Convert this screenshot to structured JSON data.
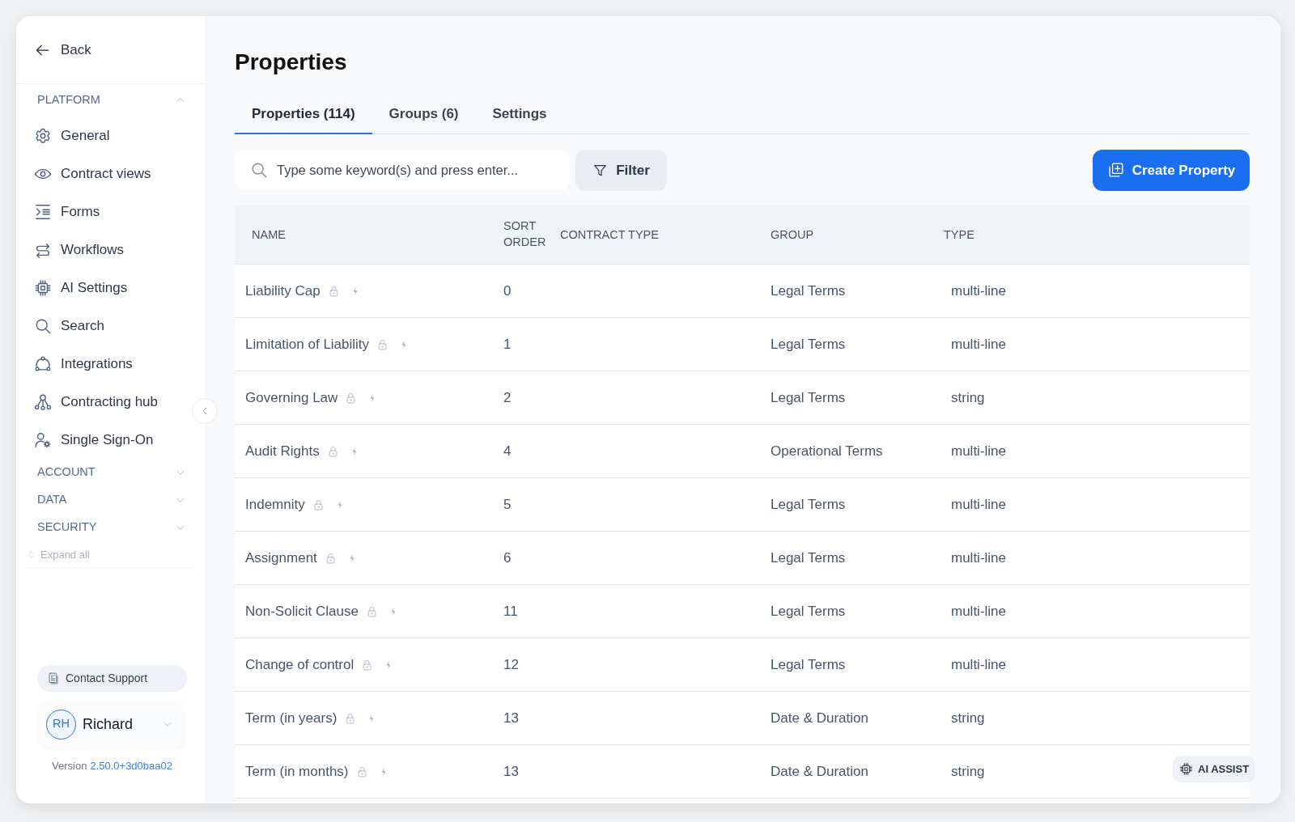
{
  "sidebar": {
    "back": "Back",
    "sections": [
      {
        "label": "PLATFORM",
        "expanded": true,
        "items": [
          "General",
          "Contract views",
          "Forms",
          "Workflows",
          "AI Settings",
          "Search",
          "Integrations",
          "Contracting hub",
          "Single Sign-On"
        ]
      },
      {
        "label": "ACCOUNT",
        "expanded": false
      },
      {
        "label": "DATA",
        "expanded": false
      },
      {
        "label": "SECURITY",
        "expanded": false
      }
    ],
    "expand_all": "Expand all",
    "contact_support": "Contact Support",
    "user": {
      "initials": "RH",
      "name": "Richard"
    },
    "version": {
      "label": "Version",
      "number": "2.50.0+3d0baa02"
    }
  },
  "page": {
    "title": "Properties",
    "tabs": [
      {
        "label": "Properties (114)",
        "selected": true
      },
      {
        "label": "Groups (6)",
        "selected": false
      },
      {
        "label": "Settings",
        "selected": false
      }
    ],
    "search": {
      "placeholder": "Type some keyword(s) and press enter..."
    },
    "filter_button": "Filter",
    "create_button": "Create Property",
    "table": {
      "columns": [
        "NAME",
        "SORT ORDER",
        "CONTRACT TYPE",
        "GROUP",
        "TYPE"
      ],
      "rows": [
        {
          "name": "Liability Cap",
          "sort_order": "0",
          "group": "Legal Terms",
          "type": "multi-line"
        },
        {
          "name": "Limitation of Liability",
          "sort_order": "1",
          "group": "Legal Terms",
          "type": "multi-line"
        },
        {
          "name": "Governing Law",
          "sort_order": "2",
          "group": "Legal Terms",
          "type": "string"
        },
        {
          "name": "Audit Rights",
          "sort_order": "4",
          "group": "Operational Terms",
          "type": "multi-line"
        },
        {
          "name": "Indemnity",
          "sort_order": "5",
          "group": "Legal Terms",
          "type": "multi-line"
        },
        {
          "name": "Assignment",
          "sort_order": "6",
          "group": "Legal Terms",
          "type": "multi-line"
        },
        {
          "name": "Non-Solicit Clause",
          "sort_order": "11",
          "group": "Legal Terms",
          "type": "multi-line"
        },
        {
          "name": "Change of control",
          "sort_order": "12",
          "group": "Legal Terms",
          "type": "multi-line"
        },
        {
          "name": "Term (in years)",
          "sort_order": "13",
          "group": "Date & Duration",
          "type": "string"
        },
        {
          "name": "Term (in months)",
          "sort_order": "13",
          "group": "Date & Duration",
          "type": "string"
        }
      ]
    },
    "ai_assist": "AI ASSIST"
  }
}
